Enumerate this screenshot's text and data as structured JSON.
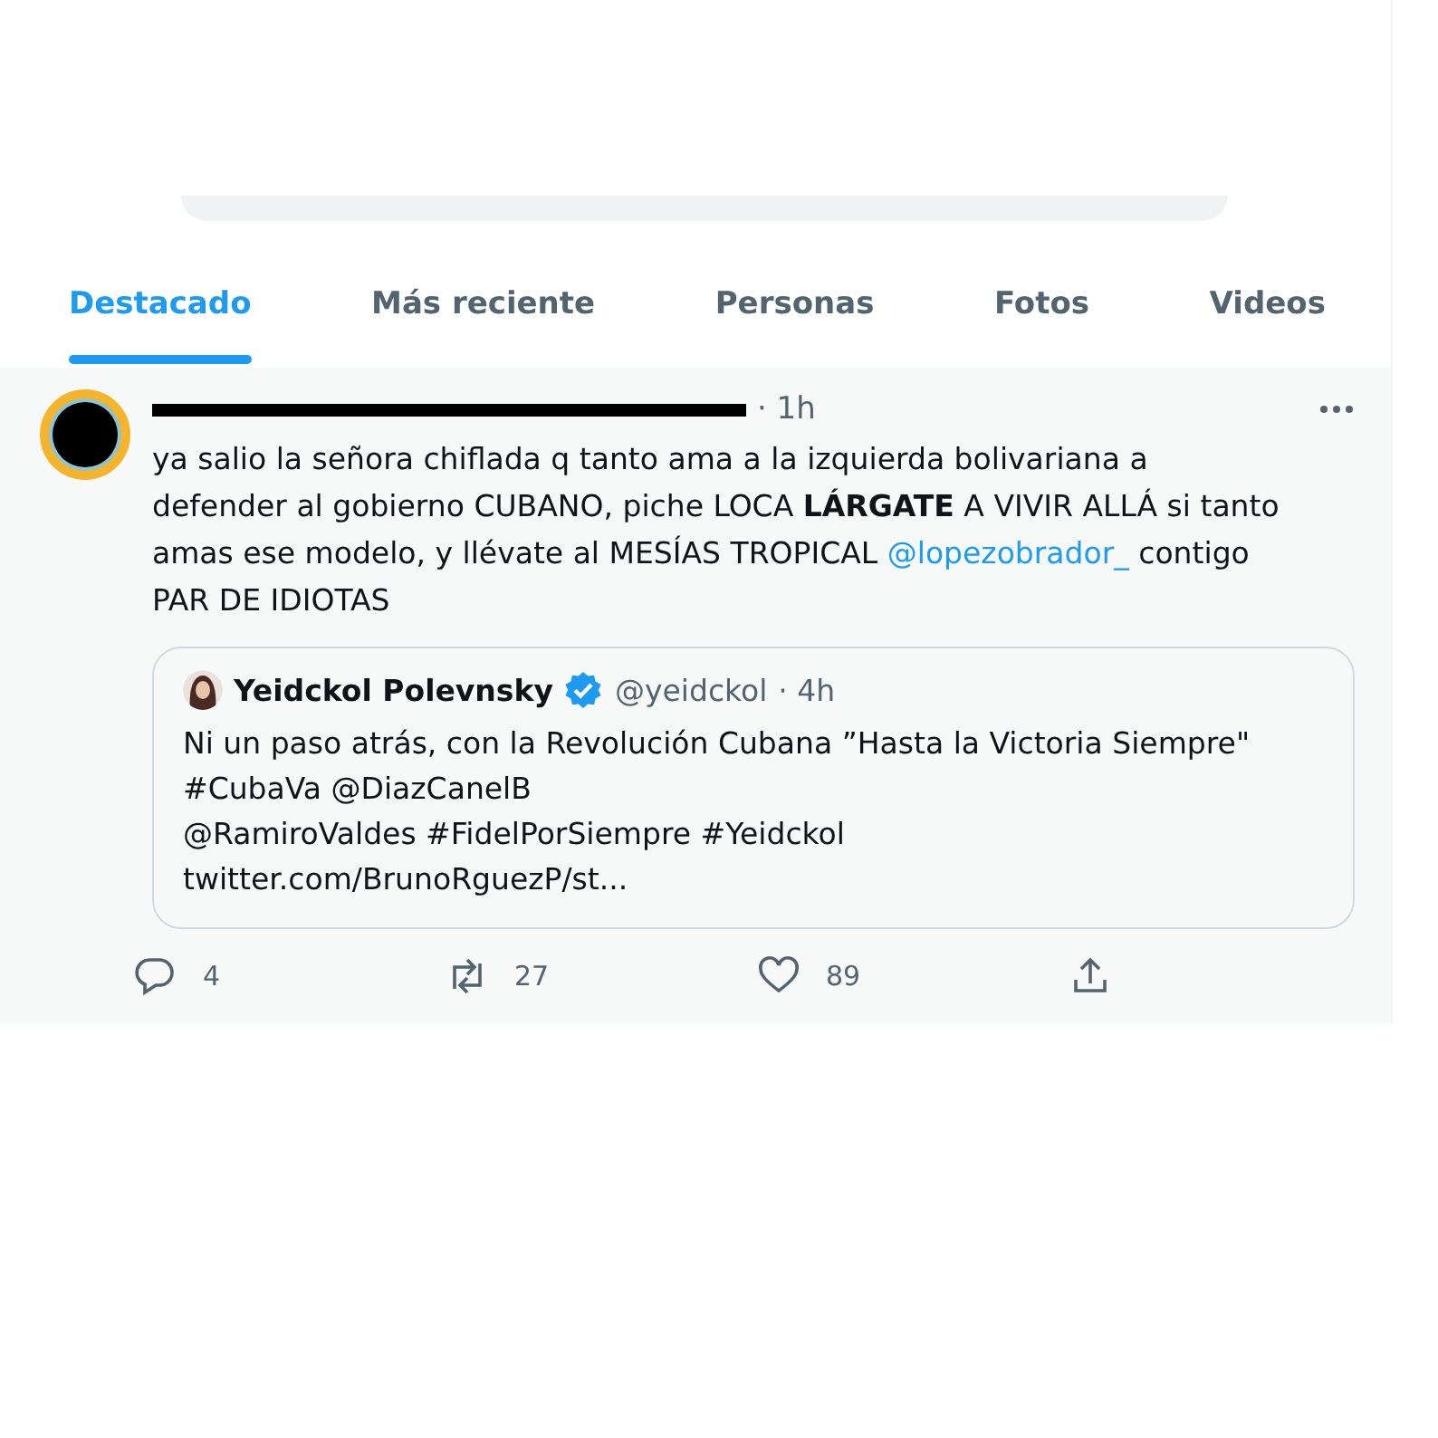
{
  "tabs": [
    {
      "label": "Destacado",
      "selected": true
    },
    {
      "label": "Más reciente",
      "selected": false
    },
    {
      "label": "Personas",
      "selected": false
    },
    {
      "label": "Fotos",
      "selected": false
    },
    {
      "label": "Videos",
      "selected": false
    }
  ],
  "tweet": {
    "time": "· 1h",
    "redacted": true,
    "text": "ya salio la señora chiflada q tanto ama a la izquierda bolivariana a defender al gobierno CUBANO, piche LOCA **LÁRGATE** A VIVIR ALLÁ si tanto amas ese modelo, y llévate al MESÍAS TROPICAL ",
    "mention": "@lopezobrador_",
    "text_after": "  contigo PAR DE IDIOTAS",
    "quote": {
      "name": "Yeidckol Polevnsky",
      "verified": true,
      "handle": "@yeidckol",
      "time": "· 4h",
      "lines": [
        "Ni un paso atrás, con la Revolución Cubana ”Hasta la Victoria Siempre\"",
        "#CubaVa @DiazCanelB",
        "@RamiroValdes #FidelPorSiempre #Yeidckol",
        "twitter.com/BrunoRguezP/st..."
      ]
    },
    "actions": [
      {
        "kind": "reply",
        "count": "4"
      },
      {
        "kind": "retweet",
        "count": "27"
      },
      {
        "kind": "like",
        "count": "89"
      },
      {
        "kind": "share"
      }
    ]
  }
}
